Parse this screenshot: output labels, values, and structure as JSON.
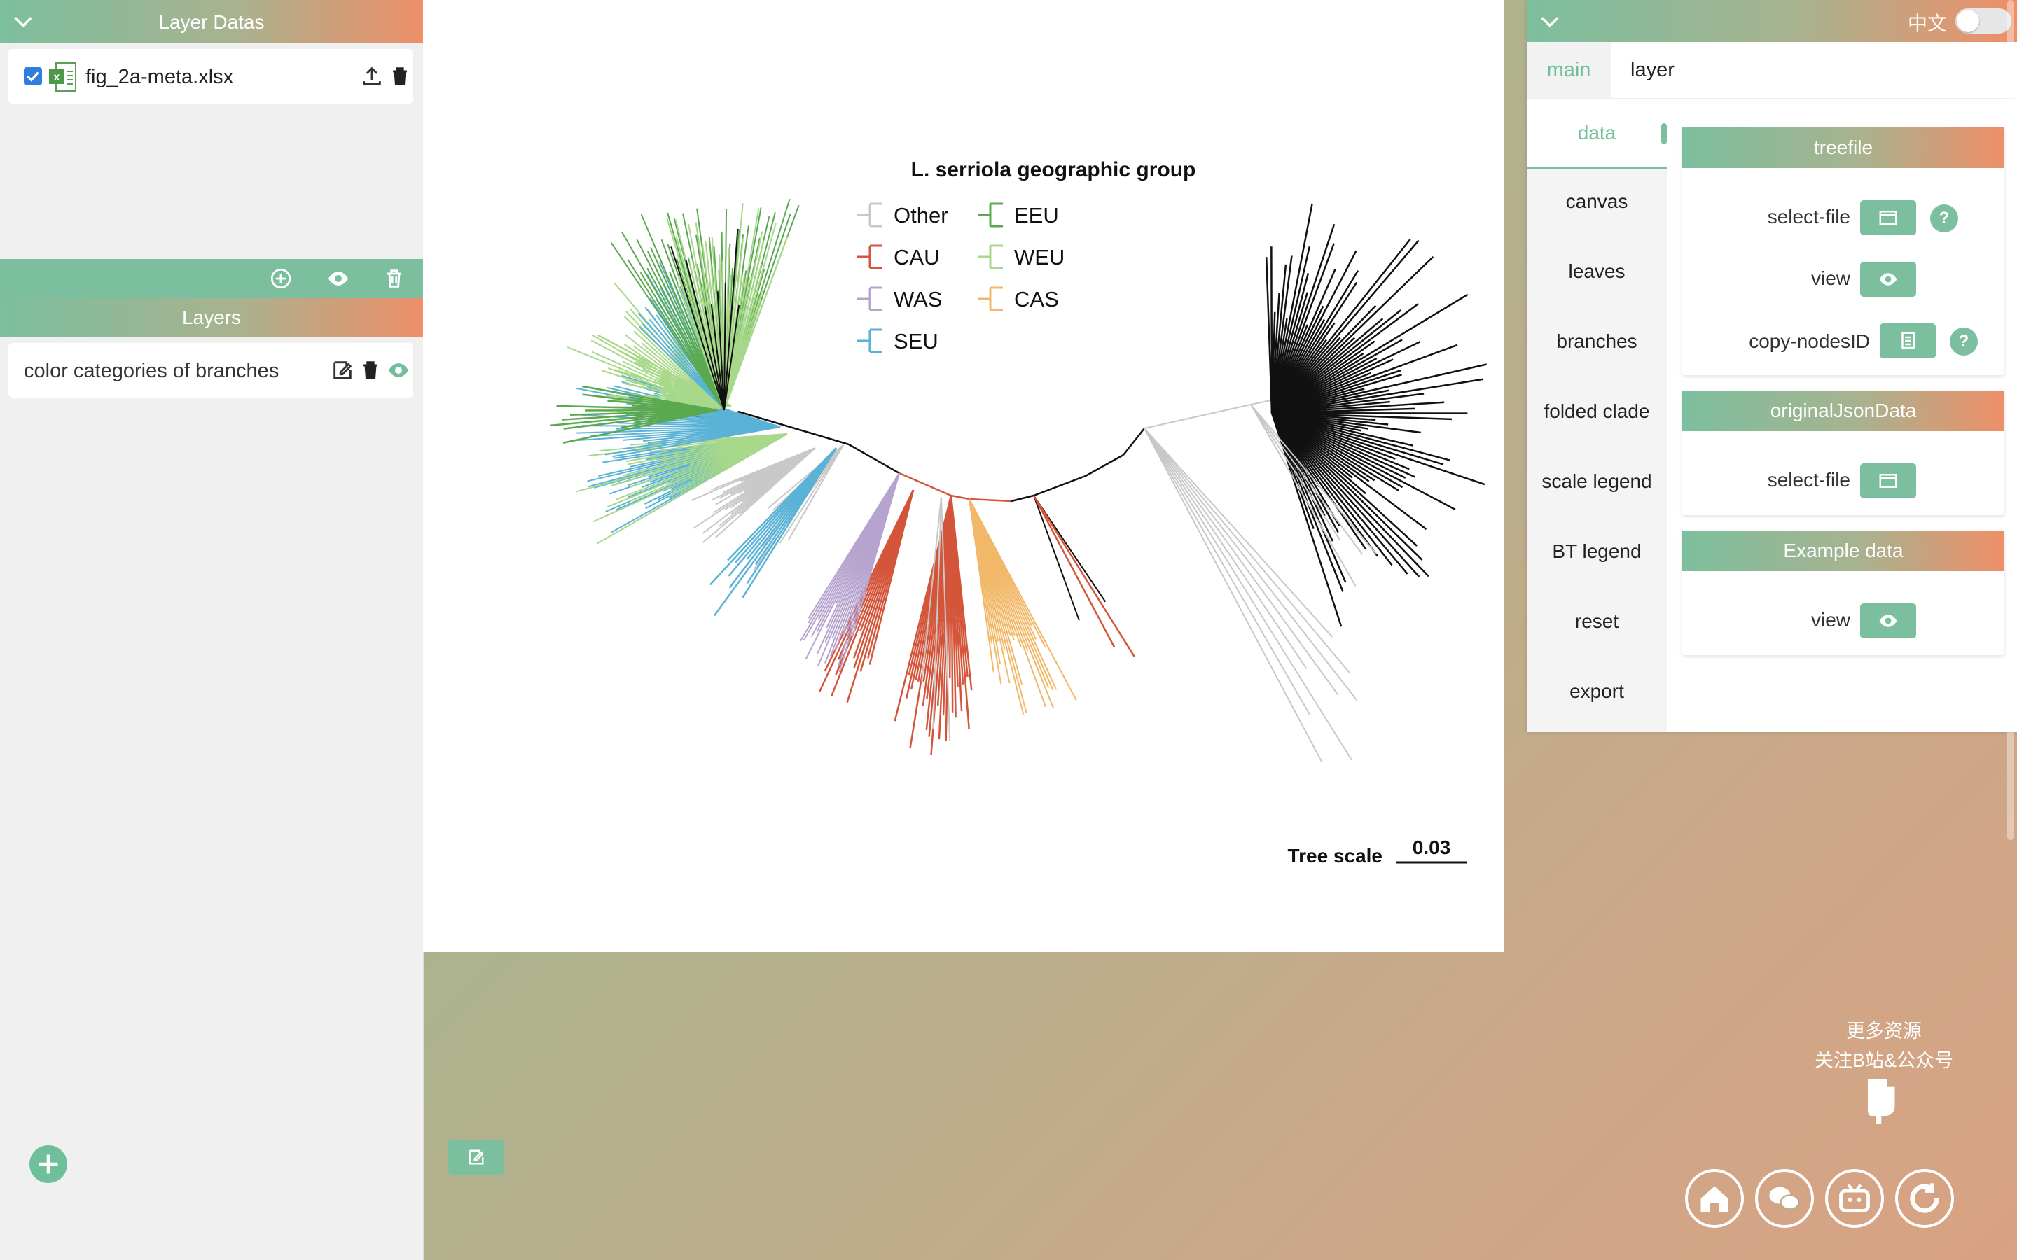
{
  "left_panel": {
    "layer_datas_title": "Layer Datas",
    "file_name": "fig_2a-meta.xlsx",
    "layers_title": "Layers",
    "layer_item": "color categories of branches"
  },
  "figure": {
    "title": "L. serriola geographic group",
    "legend": [
      {
        "label": "Other",
        "color": "#c8c8c8"
      },
      {
        "label": "CAU",
        "color": "#d4553a"
      },
      {
        "label": "WAS",
        "color": "#b6a4cf"
      },
      {
        "label": "SEU",
        "color": "#5ab3d6"
      },
      {
        "label": "EEU",
        "color": "#5aa84f"
      },
      {
        "label": "WEU",
        "color": "#a8d88a"
      },
      {
        "label": "CAS",
        "color": "#f2b86a"
      }
    ],
    "tree_scale_label": "Tree scale",
    "tree_scale_value": "0.03"
  },
  "right_panel": {
    "language": "中文",
    "tabs": [
      "main",
      "layer"
    ],
    "nav": [
      "data",
      "canvas",
      "leaves",
      "branches",
      "folded clade",
      "scale legend",
      "BT legend",
      "reset",
      "export"
    ],
    "treefile": {
      "title": "treefile",
      "select_file": "select-file",
      "view": "view",
      "copy_nodes": "copy-nodesID"
    },
    "original": {
      "title": "originalJsonData",
      "select_file": "select-file"
    },
    "example": {
      "title": "Example data",
      "view": "view"
    }
  },
  "promo": {
    "line1": "更多资源",
    "line2": "关注B站&公众号"
  },
  "icons": [
    "chevron-down-icon",
    "excel-file-icon",
    "upload-icon",
    "trash-icon",
    "add-circle-icon",
    "eye-icon",
    "edit-icon",
    "folder-icon",
    "copy-icon",
    "help-icon",
    "hand-pointer-icon",
    "home-icon",
    "wechat-icon",
    "bilibili-icon",
    "refresh-logo-icon"
  ]
}
